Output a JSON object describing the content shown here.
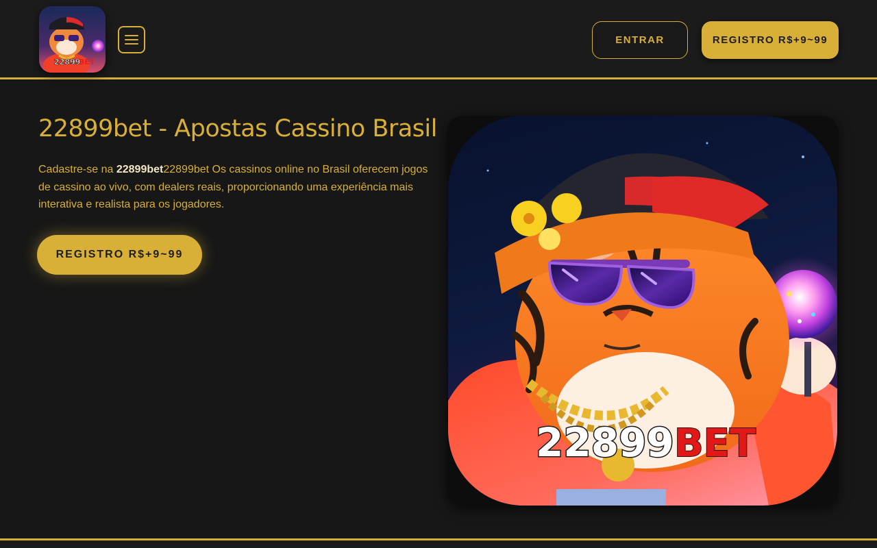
{
  "header": {
    "logo_text": "22899 BET",
    "menu_icon": "hamburger-menu-icon",
    "login_label": "ENTRAR",
    "register_label": "REGISTRO R$+9~99"
  },
  "hero": {
    "title": "22899bet - Apostas Cassino Brasil",
    "text_prefix": "Cadastre-se na ",
    "text_bold": "22899bet",
    "text_rest": "22899bet Os cassinos online no Brasil oferecem jogos de cassino ao vivo, com dealers reais, proporcionando uma experiência mais interativa e realista para os jogadores.",
    "cta_label": "REGISTRO R$+9~99",
    "image_text_number": "22899",
    "image_text_brand": "BET"
  },
  "colors": {
    "background": "#171717",
    "header_background": "#1b1b1b",
    "accent_gold": "#d8af37",
    "bold_text": "#f3e7c5",
    "button_text_dark": "#1d1d1d"
  }
}
